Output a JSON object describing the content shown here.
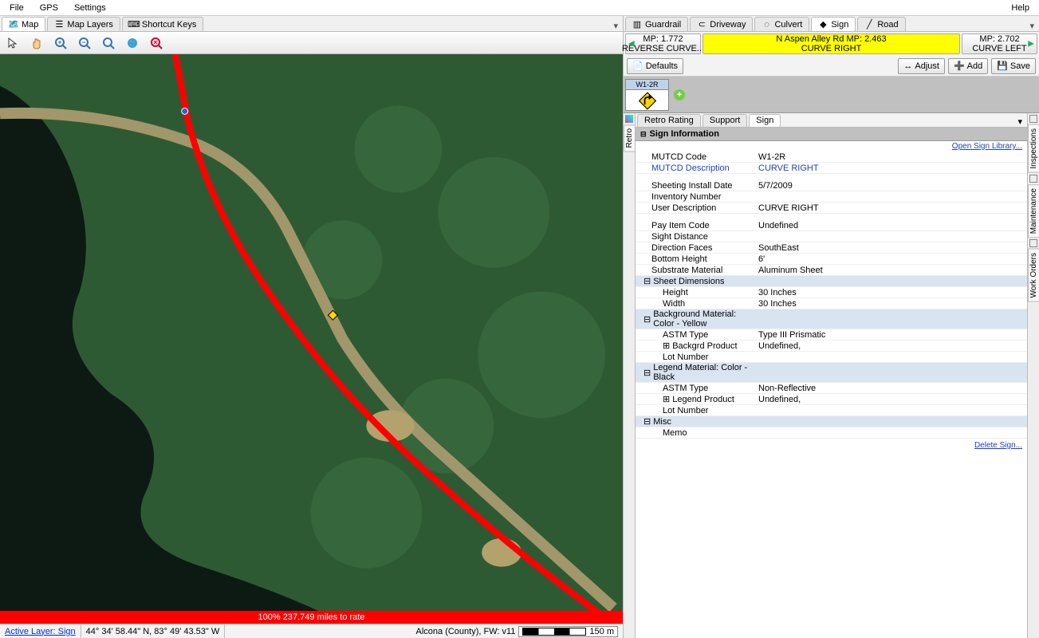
{
  "menu": {
    "file": "File",
    "gps": "GPS",
    "settings": "Settings",
    "help": "Help"
  },
  "left_tabs": [
    "Map",
    "Map Layers",
    "Shortcut Keys"
  ],
  "right_tabs": [
    "Guardrail",
    "Driveway",
    "Culvert",
    "Sign",
    "Road"
  ],
  "nav": {
    "prev_mp": "MP: 1.772",
    "prev_label": "REVERSE CURVE...",
    "center_top": "N Aspen Alley Rd MP: 2.463",
    "center_bottom": "CURVE RIGHT",
    "next_mp": "MP: 2.702",
    "next_label": "CURVE LEFT"
  },
  "buttons": {
    "defaults": "Defaults",
    "adjust": "Adjust",
    "add": "Add",
    "save": "Save"
  },
  "sign_thumb": {
    "code": "W1-2R"
  },
  "prop_tabs": [
    "Retro Rating",
    "Support",
    "Sign"
  ],
  "side_tabs_left": [
    "Retro"
  ],
  "side_tabs_right": [
    "Inspections",
    "Maintenance",
    "Work Orders"
  ],
  "section": "Sign Information",
  "open_library": "Open Sign Library...",
  "delete_sign": "Delete Sign...",
  "fields": {
    "mutcd_code": {
      "k": "MUTCD Code",
      "v": "W1-2R"
    },
    "mutcd_desc": {
      "k": "MUTCD Description",
      "v": "CURVE RIGHT"
    },
    "install_date": {
      "k": "Sheeting Install Date",
      "v": "5/7/2009"
    },
    "inventory_number": {
      "k": "Inventory Number",
      "v": ""
    },
    "user_desc": {
      "k": "User Description",
      "v": "CURVE RIGHT"
    },
    "pay_item": {
      "k": "Pay Item Code",
      "v": "Undefined"
    },
    "sight_distance": {
      "k": "Sight Distance",
      "v": ""
    },
    "direction_faces": {
      "k": "Direction Faces",
      "v": "SouthEast"
    },
    "bottom_height": {
      "k": "Bottom Height",
      "v": "6'"
    },
    "substrate": {
      "k": "Substrate Material",
      "v": "Aluminum Sheet"
    },
    "sheet_dims": {
      "k": "Sheet Dimensions",
      "v": ""
    },
    "height": {
      "k": "Height",
      "v": "30 Inches"
    },
    "width": {
      "k": "Width",
      "v": "30 Inches"
    },
    "bg_material": {
      "k": "Background Material: Color - Yellow",
      "v": ""
    },
    "bg_astm": {
      "k": "ASTM Type",
      "v": "Type III Prismatic"
    },
    "bg_product": {
      "k": "Backgrd Product",
      "v": "Undefined,"
    },
    "bg_lot": {
      "k": "Lot Number",
      "v": ""
    },
    "legend_material": {
      "k": "Legend Material: Color - Black",
      "v": ""
    },
    "leg_astm": {
      "k": "ASTM Type",
      "v": "Non-Reflective"
    },
    "leg_product": {
      "k": "Legend Product",
      "v": "Undefined,"
    },
    "leg_lot": {
      "k": "Lot Number",
      "v": ""
    },
    "misc": {
      "k": "Misc",
      "v": ""
    },
    "memo": {
      "k": "Memo",
      "v": ""
    }
  },
  "progress": "100% 237.749 miles to rate",
  "status": {
    "active_layer": "Active Layer: Sign",
    "coords": "44° 34' 58.44\" N, 83° 49' 43.53\" W",
    "region": "Alcona (County), FW: v11",
    "scale": "150 m"
  }
}
